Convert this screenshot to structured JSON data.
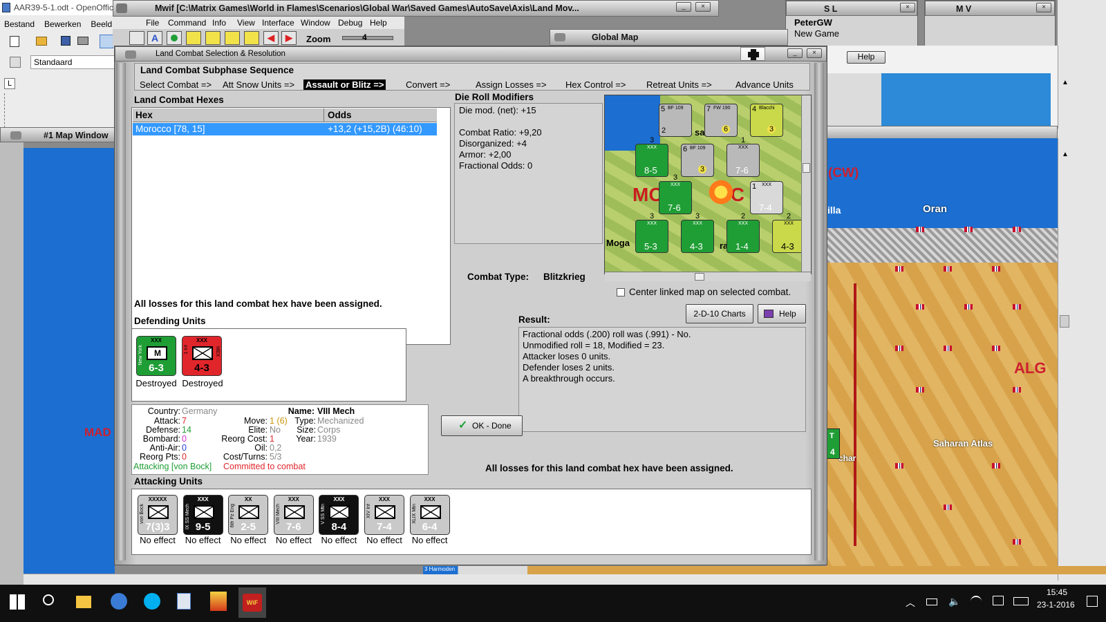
{
  "colors": {
    "desktop": "#8a8a8a",
    "ocean": "#1c6fd1",
    "friendly_green": "#1f9e35",
    "enemy_red": "#e0262b",
    "axis_black": "#111111",
    "axis_gray": "#b9b9b9",
    "sea_label": "#cc1f2e",
    "taskbar": "#101010"
  },
  "oo": {
    "title": "AAR39-5-1.odt - OpenOffic",
    "menu": [
      "Bestand",
      "Bewerken",
      "Beeld"
    ],
    "style_box": "Standaard",
    "ruler_icon": "L"
  },
  "main": {
    "title": "Mwif [C:\\Matrix Games\\World in Flames\\Scenarios\\Global War\\Saved Games\\AutoSave\\Axis\\Land Mov...",
    "menu": [
      "File",
      "Command",
      "Info",
      "View",
      "Interface",
      "Window",
      "Debug",
      "Help"
    ],
    "zoom_label": "Zoom",
    "zoom_value": "4"
  },
  "side_windows": {
    "sl": "S L",
    "mv": "M V",
    "player_name": "PeterGW",
    "player_sub": "New Game",
    "global_map": "Global Map",
    "map_window": "#1 Map Window",
    "help_stub": "Help"
  },
  "map_labels": {
    "cw": "(CW)",
    "villa": "illa",
    "oran": "Oran",
    "alg": "ALG",
    "saharan": "Saharan Atlas",
    "char": "char",
    "mad": "MAD",
    "unit_stub": "T",
    "unit_stub_val": "4",
    "bottom_stub": "3 Harmoden"
  },
  "dialog": {
    "title": "Land Combat Selection & Resolution",
    "seq_title": "Land Combat Subphase Sequence",
    "sequence": [
      "Select Combat =>",
      "Att Snow Units =>",
      "Assault or Blitz =>",
      "Convert =>",
      "Assign Losses =>",
      "Hex Control =>",
      "Retreat Units =>",
      "Advance Units"
    ],
    "active_step": "Assault or Blitz =>",
    "hexes_label": "Land Combat Hexes",
    "col_hex": "Hex",
    "col_odds": "Odds",
    "rows": [
      {
        "hex": "Morocco [78, 15]",
        "odds": "+13,2 (+15,2B) (46:10)"
      }
    ],
    "losses_note": "All losses for this land combat hex have been assigned.",
    "die_title": "Die Roll Modifiers",
    "die_lines": [
      "Die mod. (net): +15",
      "",
      "Combat Ratio: +9,20",
      "Disorganized: +4",
      "Armor: +2,00",
      "Fractional Odds: 0"
    ],
    "combat_type_label": "Combat Type:",
    "combat_type": "Blitzkrieg",
    "center_checkbox": "Center linked map on selected combat.",
    "charts_btn": "2-D-10 Charts",
    "help_btn": "Help",
    "result_label": "Result:",
    "result_lines": [
      "Fractional odds (.200) roll was (.991)  - No.",
      "Unmodified roll = 18, Modified = 23.",
      "Attacker loses 0 units.",
      "Defender loses 2 units.",
      "A breakthrough occurs."
    ],
    "ok_btn": "OK - Done",
    "bottom_note": "All losses for this land combat hex have been assigned.",
    "defending_label": "Defending Units",
    "defenders": [
      {
        "name": "New York",
        "size": "XXX",
        "value": "6-3",
        "sym": "M",
        "status": "Destroyed",
        "color": "#1f9e35"
      },
      {
        "name": "1 Inf",
        "size": "XXX",
        "value": "4-3",
        "sym": "",
        "status": "Destroyed",
        "color": "#e0262b"
      }
    ],
    "defender_tag": "MEX",
    "attacking_label": "Attacking Units",
    "attackers": [
      {
        "name": "von Bock",
        "size": "XXXXX",
        "value": "7(3)3",
        "status": "No effect",
        "color": "#c9c9c9",
        "text": "#ffffff"
      },
      {
        "name": "IX SS Mech",
        "size": "XXX",
        "value": "9-5",
        "status": "No effect",
        "color": "#111111",
        "text": "#ffffff"
      },
      {
        "name": "6th Pz Eng",
        "size": "XX",
        "value": "2-5",
        "status": "No effect",
        "color": "#c9c9c9",
        "text": "#ffffff"
      },
      {
        "name": "VIII Mech",
        "size": "XXX",
        "value": "7-6",
        "status": "No effect",
        "color": "#c9c9c9",
        "text": "#ffffff"
      },
      {
        "name": "V SS Mtn",
        "size": "XXX",
        "value": "8-4",
        "status": "No effect",
        "color": "#111111",
        "text": "#ffffff"
      },
      {
        "name": "XIV Inf",
        "size": "XXX",
        "value": "7-4",
        "status": "No effect",
        "color": "#c9c9c9",
        "text": "#ffffff"
      },
      {
        "name": "XLIX Mtn",
        "size": "XXX",
        "value": "6-4",
        "status": "No effect",
        "color": "#c9c9c9",
        "text": "#ffffff"
      }
    ],
    "info": {
      "country_k": "Country:",
      "country_v": "Germany",
      "attack_k": "Attack:",
      "attack_v": "7",
      "defense_k": "Defense:",
      "defense_v": "14",
      "bombard_k": "Bombard:",
      "bombard_v": "0",
      "antiair_k": "Anti-Air:",
      "antiair_v": "0",
      "reorg_k": "Reorg Pts:",
      "reorg_v": "0",
      "name_k": "Name:",
      "name_v": "VIII Mech",
      "move_k": "Move:",
      "move_v": "1 (6)",
      "type_k": "Type:",
      "type_v": "Mechanized",
      "elite_k": "Elite:",
      "elite_v": "No",
      "size_k": "Size:",
      "size_v": "Corps",
      "reorgcost_k": "Reorg Cost:",
      "reorgcost_v": "1",
      "year_k": "Year:",
      "year_v": "1939",
      "oil_k": "Oil:",
      "oil_v": "0,2",
      "cost_k": "Cost/Turns:",
      "cost_v": "5/3",
      "attacking_note": "Attacking [von Bock]",
      "committed_note": "Committed to combat"
    },
    "minimap": {
      "label_mo": "MO",
      "label_dc": "OC",
      "label_moga": "Moga",
      "label_sal": "sal",
      "label_rai": "rai",
      "counters": [
        {
          "name": "BF 109",
          "value": "2",
          "num": "5",
          "color": "#b9b9b9"
        },
        {
          "name": "FW 190",
          "value": "6",
          "num": "7",
          "color": "#b9b9b9"
        },
        {
          "name": "Blacchi",
          "value": "3",
          "num": "4",
          "color": "#c9d94a"
        },
        {
          "name": "XXX",
          "value": "8-5",
          "num": "3",
          "color": "#1f9e35"
        },
        {
          "name": "BF 109",
          "value": "3",
          "num": "6",
          "color": "#b9b9b9"
        },
        {
          "name": "XXX",
          "value": "7-6",
          "num": "1",
          "color": "#b9b9b9"
        },
        {
          "name": "XXX",
          "value": "7-6",
          "num": "3",
          "color": "#1f9e35"
        },
        {
          "name": "XXX",
          "value": "7-4",
          "num": "1",
          "color": "#b9b9b9"
        },
        {
          "name": "XXX",
          "value": "5-3",
          "num": "3",
          "color": "#1f9e35"
        },
        {
          "name": "XXX",
          "value": "4-3",
          "num": "3",
          "color": "#1f9e35"
        },
        {
          "name": "XXX",
          "value": "1-4",
          "num": "2",
          "color": "#1f9e35"
        },
        {
          "name": "XXX",
          "value": "4-3",
          "num": "2",
          "color": "#c9d94a"
        }
      ]
    }
  },
  "taskbar": {
    "time": "15:45",
    "date": "23-1-2016",
    "apps": [
      "windows-start",
      "search",
      "file-explorer",
      "thunderbird",
      "skype",
      "openoffice",
      "mwif-flames",
      "mwif"
    ]
  }
}
